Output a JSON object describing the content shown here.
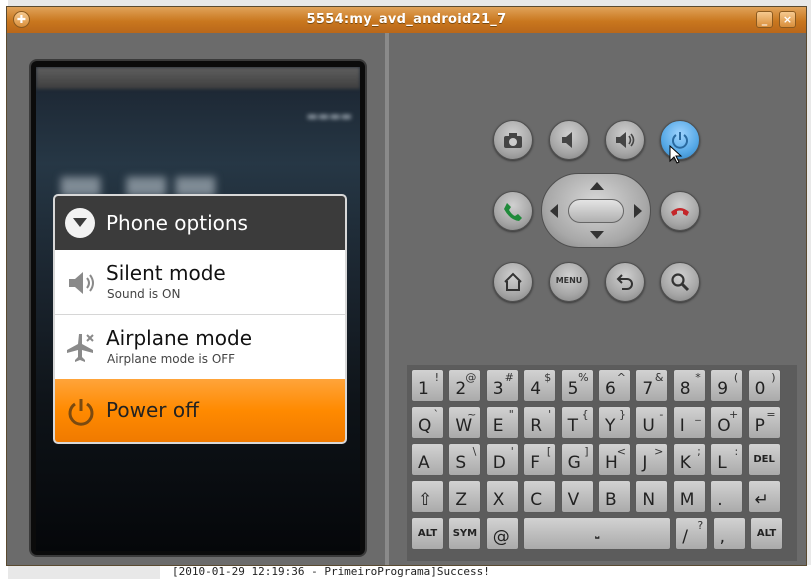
{
  "window": {
    "title": "5554:my_avd_android21_7",
    "minimize_label": "_",
    "close_label": "×"
  },
  "background": {
    "log_line": "[2010-01-29 12:19:36 - PrimeiroPrograma]Success!"
  },
  "dialog": {
    "title": "Phone options",
    "options": [
      {
        "title": "Silent mode",
        "subtitle": "Sound is ON",
        "icon": "speaker-icon"
      },
      {
        "title": "Airplane mode",
        "subtitle": "Airplane mode is OFF",
        "icon": "airplane-icon"
      },
      {
        "title": "Power off",
        "subtitle": "",
        "icon": "power-icon",
        "highlighted": true
      }
    ]
  },
  "controls": {
    "row1": [
      "camera-icon",
      "volume-down-icon",
      "volume-up-icon",
      "power-icon"
    ],
    "row2": [
      "call-icon",
      "dpad",
      "end-call-icon"
    ],
    "row3": [
      "home-icon",
      "menu",
      "back-icon",
      "search-icon"
    ],
    "menu_label": "MENU"
  },
  "keyboard": {
    "rows": [
      [
        {
          "p": "1",
          "s": "!"
        },
        {
          "p": "2",
          "s": "@"
        },
        {
          "p": "3",
          "s": "#"
        },
        {
          "p": "4",
          "s": "$"
        },
        {
          "p": "5",
          "s": "%"
        },
        {
          "p": "6",
          "s": "^"
        },
        {
          "p": "7",
          "s": "&"
        },
        {
          "p": "8",
          "s": "*"
        },
        {
          "p": "9",
          "s": "("
        },
        {
          "p": "0",
          "s": ")"
        }
      ],
      [
        {
          "p": "Q",
          "s": "`"
        },
        {
          "p": "W",
          "s": "~"
        },
        {
          "p": "E",
          "s": "\""
        },
        {
          "p": "R",
          "s": "'"
        },
        {
          "p": "T",
          "s": "{"
        },
        {
          "p": "Y",
          "s": "}"
        },
        {
          "p": "U",
          "s": "-"
        },
        {
          "p": "I",
          "s": "_"
        },
        {
          "p": "O",
          "s": "+"
        },
        {
          "p": "P",
          "s": "="
        }
      ],
      [
        {
          "p": "A",
          "s": ""
        },
        {
          "p": "S",
          "s": "\\"
        },
        {
          "p": "D",
          "s": "'"
        },
        {
          "p": "F",
          "s": "["
        },
        {
          "p": "G",
          "s": "]"
        },
        {
          "p": "H",
          "s": "<"
        },
        {
          "p": "J",
          "s": ">"
        },
        {
          "p": "K",
          "s": ";"
        },
        {
          "p": "L",
          "s": ":"
        },
        {
          "p": "DEL",
          "s": ""
        }
      ],
      [
        {
          "p": "⇧",
          "s": ""
        },
        {
          "p": "Z",
          "s": ""
        },
        {
          "p": "X",
          "s": ""
        },
        {
          "p": "C",
          "s": ""
        },
        {
          "p": "V",
          "s": ""
        },
        {
          "p": "B",
          "s": ""
        },
        {
          "p": "N",
          "s": ""
        },
        {
          "p": "M",
          "s": ""
        },
        {
          "p": ".",
          "s": ""
        },
        {
          "p": "↵",
          "s": ""
        }
      ],
      [
        {
          "p": "ALT",
          "s": ""
        },
        {
          "p": "SYM",
          "s": ""
        },
        {
          "p": "@",
          "s": ""
        },
        {
          "p": "SPACE",
          "s": ""
        },
        {
          "p": "/",
          "s": "?"
        },
        {
          "p": ",",
          "s": ""
        },
        {
          "p": "ALT",
          "s": ""
        }
      ]
    ]
  },
  "colors": {
    "titlebar": "#c9771e",
    "highlight": "#ff8a00",
    "power_button": "#55a8e6"
  }
}
